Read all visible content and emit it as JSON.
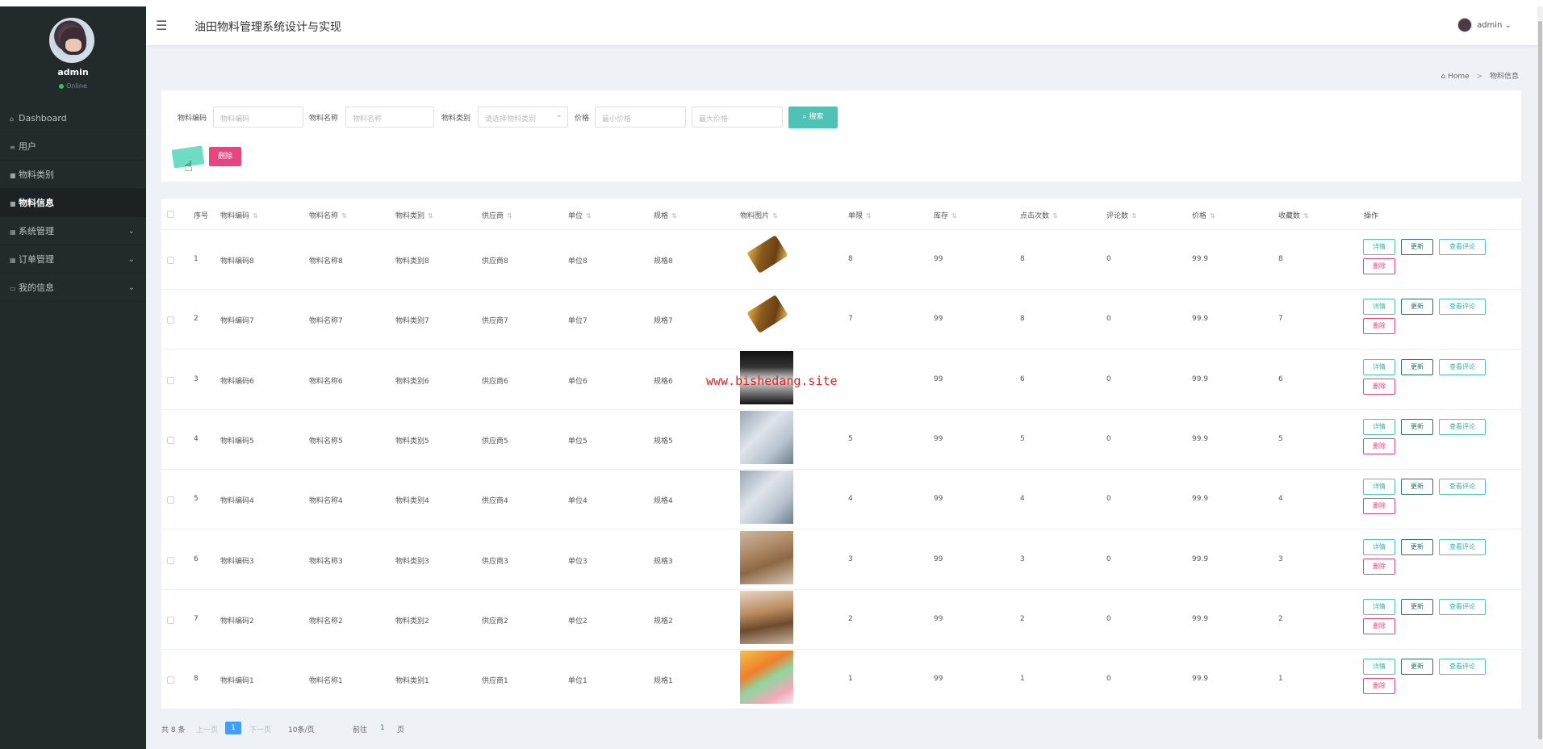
{
  "app": {
    "title": "油田物料管理系统设计与实现"
  },
  "sidebar": {
    "username": "admin",
    "status": "Online",
    "items": [
      {
        "label": "Dashboard",
        "icon": "home-icon",
        "expandable": false,
        "active": false
      },
      {
        "label": "用户",
        "icon": "list-icon",
        "expandable": false,
        "active": false
      },
      {
        "label": "物料类别",
        "icon": "square-icon",
        "expandable": false,
        "active": false
      },
      {
        "label": "物料信息",
        "icon": "square-icon",
        "expandable": false,
        "active": true
      },
      {
        "label": "系统管理",
        "icon": "grid-icon",
        "expandable": true,
        "active": false
      },
      {
        "label": "订单管理",
        "icon": "grid-icon",
        "expandable": true,
        "active": false
      },
      {
        "label": "我的信息",
        "icon": "card-icon",
        "expandable": true,
        "active": false
      }
    ]
  },
  "header": {
    "user": "admin",
    "user_caret": "⌄"
  },
  "breadcrumb": {
    "home": "Home",
    "separator": ">",
    "current": "物料信息"
  },
  "filters": {
    "code_label": "物料编码",
    "code_placeholder": "物料编码",
    "name_label": "物料名称",
    "name_placeholder": "物料名称",
    "category_label": "物料类别",
    "category_placeholder": "请选择物料类别",
    "price_label": "价格",
    "price_min_placeholder": "最小价格",
    "price_max_placeholder": "最大价格",
    "search_label": "搜索",
    "delete_label": "删除"
  },
  "table": {
    "columns": [
      "序号",
      "物料编码",
      "物料名称",
      "物料类别",
      "供应商",
      "单位",
      "规格",
      "物料图片",
      "单限",
      "库存",
      "点击次数",
      "评论数",
      "价格",
      "收藏数",
      "操作"
    ],
    "actions": {
      "detail": "详情",
      "update": "更新",
      "review": "查看评论",
      "delete": "删除"
    },
    "rows": [
      {
        "idx": "1",
        "code": "物料编码8",
        "name": "物料名称8",
        "category": "物料类别8",
        "supplier": "供应商8",
        "unit": "单位8",
        "spec": "规格8",
        "image": "chocolate",
        "limit": "8",
        "stock": "99",
        "clicks": "8",
        "comments": "0",
        "price": "99.9",
        "favorites": "8"
      },
      {
        "idx": "2",
        "code": "物料编码7",
        "name": "物料名称7",
        "category": "物料类别7",
        "supplier": "供应商7",
        "unit": "单位7",
        "spec": "规格7",
        "image": "chocolate",
        "limit": "7",
        "stock": "99",
        "clicks": "8",
        "comments": "0",
        "price": "99.9",
        "favorites": "7"
      },
      {
        "idx": "3",
        "code": "物料编码6",
        "name": "物料名称6",
        "category": "物料类别6",
        "supplier": "供应商6",
        "unit": "单位6",
        "spec": "规格6",
        "image": "noodles",
        "limit": "",
        "stock": "99",
        "clicks": "6",
        "comments": "0",
        "price": "99.9",
        "favorites": "6"
      },
      {
        "idx": "4",
        "code": "物料编码5",
        "name": "物料名称5",
        "category": "物料类别5",
        "supplier": "供应商5",
        "unit": "单位5",
        "spec": "规格5",
        "image": "tubes",
        "limit": "5",
        "stock": "99",
        "clicks": "5",
        "comments": "0",
        "price": "99.9",
        "favorites": "5"
      },
      {
        "idx": "5",
        "code": "物料编码4",
        "name": "物料名称4",
        "category": "物料类别4",
        "supplier": "供应商4",
        "unit": "单位4",
        "spec": "规格4",
        "image": "tubes",
        "limit": "4",
        "stock": "99",
        "clicks": "4",
        "comments": "0",
        "price": "99.9",
        "favorites": "4"
      },
      {
        "idx": "6",
        "code": "物料编码3",
        "name": "物料名称3",
        "category": "物料类别3",
        "supplier": "供应商3",
        "unit": "单位3",
        "spec": "规格3",
        "image": "bags",
        "limit": "3",
        "stock": "99",
        "clicks": "3",
        "comments": "0",
        "price": "99.9",
        "favorites": "3"
      },
      {
        "idx": "7",
        "code": "物料编码2",
        "name": "物料名称2",
        "category": "物料类别2",
        "supplier": "供应商2",
        "unit": "单位2",
        "spec": "规格2",
        "image": "fish",
        "limit": "2",
        "stock": "99",
        "clicks": "2",
        "comments": "0",
        "price": "99.9",
        "favorites": "2"
      },
      {
        "idx": "8",
        "code": "物料编码1",
        "name": "物料名称1",
        "category": "物料类别1",
        "supplier": "供应商1",
        "unit": "单位1",
        "spec": "规格1",
        "image": "fruit",
        "limit": "1",
        "stock": "99",
        "clicks": "1",
        "comments": "0",
        "price": "99.9",
        "favorites": "1"
      }
    ]
  },
  "watermark": "www.bishedang.site",
  "pagination": {
    "total": "共 8 条",
    "prev": "上一页",
    "current": "1",
    "next": "下一页",
    "page_size": "10条/页",
    "goto": "前往",
    "goto_value": "1",
    "page_unit": "页"
  },
  "colors": {
    "sidebar_bg": "#232a2b",
    "primary": "#4ec3b5",
    "danger": "#e6467f",
    "page_active": "#409eff"
  }
}
